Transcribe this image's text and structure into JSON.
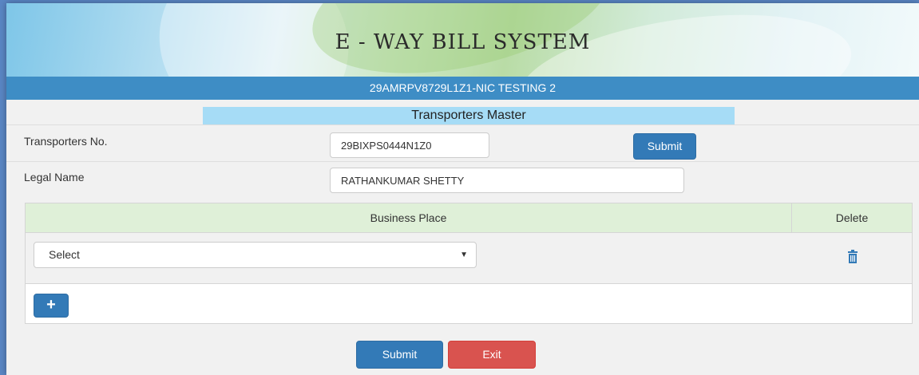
{
  "header": {
    "title": "E - WAY BILL SYSTEM",
    "gstin_user": "29AMRPV8729L1Z1-NIC TESTING 2"
  },
  "form": {
    "section_title": "Transporters Master",
    "transporter_no_label": "Transporters No.",
    "transporter_no_value": "29BIXPS0444N1Z0",
    "inline_submit_label": "Submit",
    "legal_name_label": "Legal Name",
    "legal_name_value": "RATHANKUMAR SHETTY"
  },
  "business_table": {
    "columns": [
      "Business Place",
      "Delete"
    ],
    "rows": [
      {
        "business_place_selected": "Select",
        "delete_icon": "trash-icon"
      }
    ],
    "add_icon": "plus-icon"
  },
  "actions": {
    "submit_label": "Submit",
    "exit_label": "Exit"
  },
  "colors": {
    "header_bar": "#3e8dc5",
    "section_title_bg": "#a6dcf6",
    "table_header_bg": "#dff0d8",
    "primary": "#337ab7",
    "danger": "#d9534f"
  }
}
